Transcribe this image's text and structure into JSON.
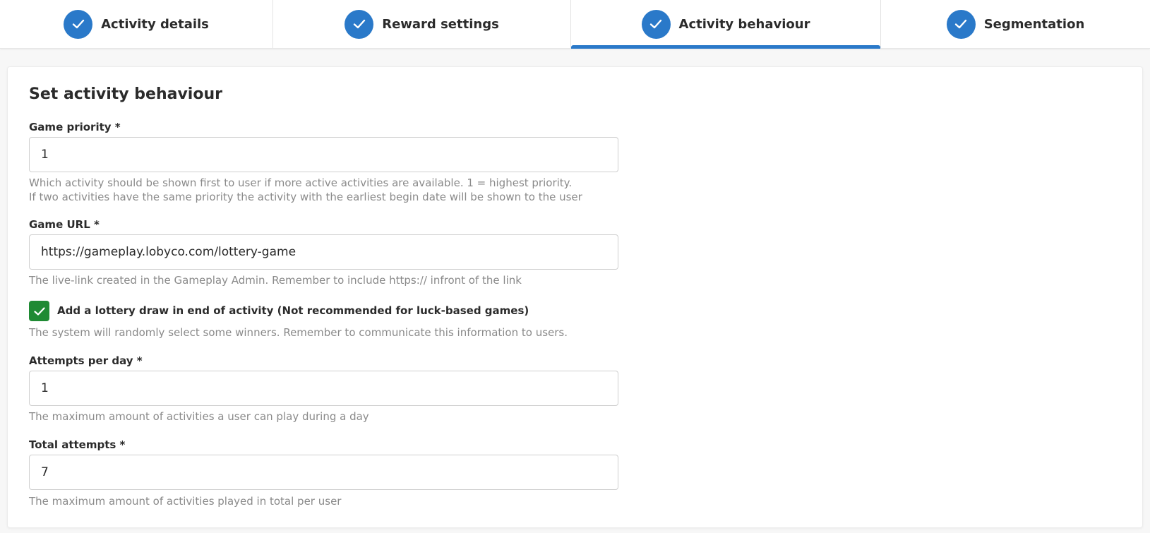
{
  "steps": [
    {
      "label": "Activity details",
      "completed": true,
      "active": false
    },
    {
      "label": "Reward settings",
      "completed": true,
      "active": false
    },
    {
      "label": "Activity behaviour",
      "completed": true,
      "active": true
    },
    {
      "label": "Segmentation",
      "completed": true,
      "active": false
    }
  ],
  "colors": {
    "accent": "#2a79c9",
    "checkbox_checked": "#1f8a33",
    "help_text": "#8a8a8a"
  },
  "form": {
    "title": "Set activity behaviour",
    "game_priority": {
      "label": "Game priority *",
      "value": "1",
      "help_line1": "Which activity should be shown first to user if more active activities are available. 1 = highest priority.",
      "help_line2": "If two activities have the same priority the activity with the earliest begin date will be shown to the user"
    },
    "game_url": {
      "label": "Game URL *",
      "value": "https://gameplay.lobyco.com/lottery-game",
      "help": "The live-link created in the Gameplay Admin. Remember to include https:// infront of the link"
    },
    "lottery_draw": {
      "label": "Add a lottery draw in end of activity (Not recommended for luck-based games)",
      "checked": true,
      "help": "The system will randomly select some winners. Remember to communicate this information to users."
    },
    "attempts_per_day": {
      "label": "Attempts per day *",
      "value": "1",
      "help": "The maximum amount of activities a user can play during a day"
    },
    "total_attempts": {
      "label": "Total attempts *",
      "value": "7",
      "help": "The maximum amount of activities played in total per user"
    }
  }
}
